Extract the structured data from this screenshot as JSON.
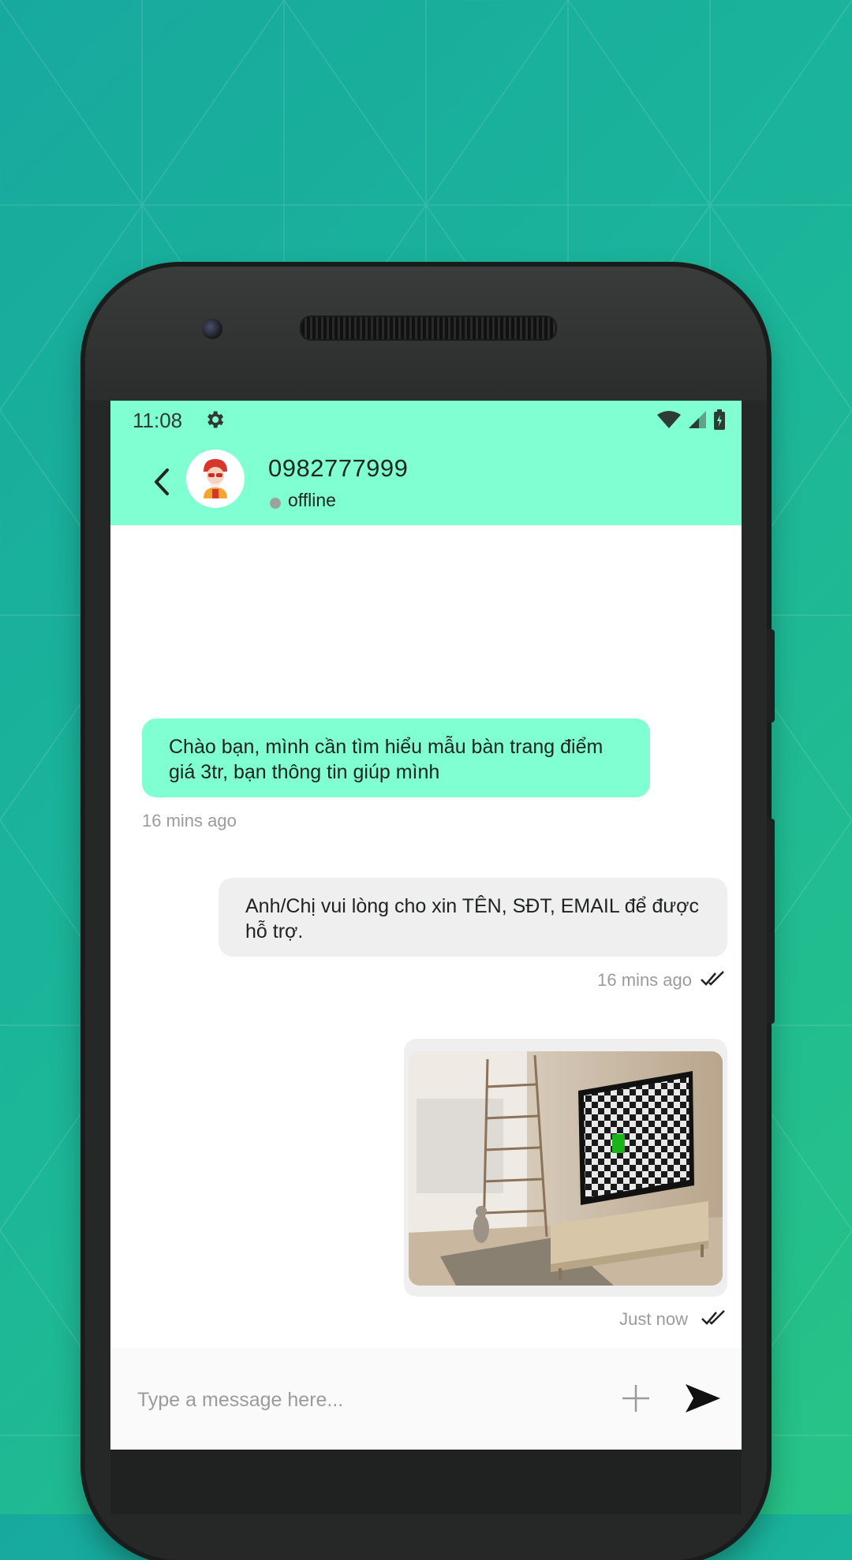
{
  "status_bar": {
    "time": "11:08",
    "icons": [
      "gear-icon",
      "wifi-icon",
      "signal-icon",
      "battery-icon"
    ]
  },
  "header": {
    "contact_name": "0982777999",
    "status": "offline",
    "back_icon": "chevron-left-icon"
  },
  "messages": [
    {
      "direction": "incoming",
      "text": "Chào bạn, mình cần tìm hiểu mẫu bàn trang điểm giá 3tr, bạn thông tin giúp mình",
      "time": "16 mins ago"
    },
    {
      "direction": "outgoing",
      "text": "Anh/Chị vui lòng cho xin TÊN, SĐT, EMAIL để được hỗ trợ.",
      "time": "16 mins ago",
      "read_icon": "double-check-icon"
    },
    {
      "direction": "outgoing",
      "type": "image",
      "time": "Just now",
      "read_icon": "double-check-icon"
    }
  ],
  "composer": {
    "placeholder": "Type a message here...",
    "attach_icon": "plus-icon",
    "send_icon": "send-icon"
  },
  "colors": {
    "accent": "#80ffd2",
    "outgoing_bubble": "#efefef",
    "background_start": "#17a99e",
    "background_end": "#27c386"
  }
}
